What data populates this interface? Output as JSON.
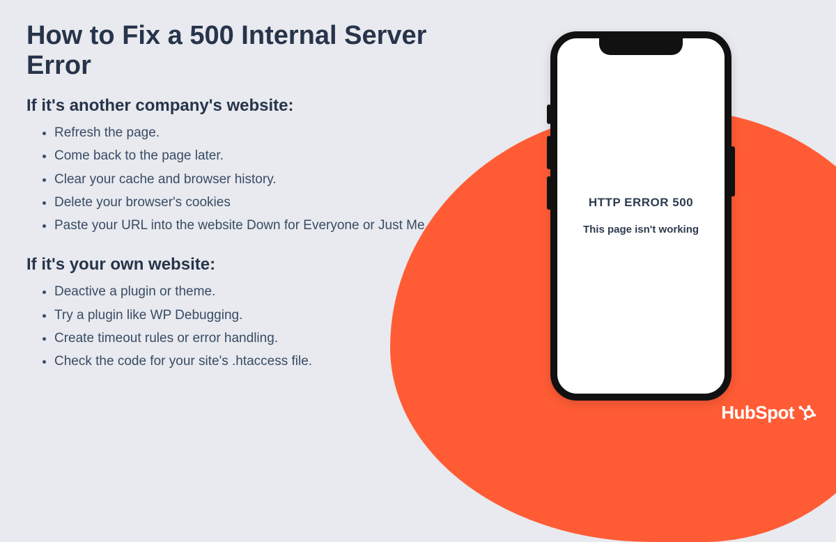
{
  "title": "How to Fix a 500 Internal Server Error",
  "sections": [
    {
      "heading": "If it's another company's website:",
      "items": [
        "Refresh the page.",
        "Come back to the page later.",
        "Clear your cache and browser history.",
        "Delete your browser's cookies",
        "Paste your URL into the website Down for Everyone or Just Me"
      ]
    },
    {
      "heading": "If it's your own website:",
      "items": [
        "Deactive a plugin or theme.",
        "Try a plugin like WP Debugging.",
        "Create timeout rules or error handling.",
        "Check the code for your site's .htaccess file."
      ]
    }
  ],
  "phone": {
    "error_title": "HTTP ERROR 500",
    "error_sub": "This page isn't working"
  },
  "brand": "HubSpot",
  "colors": {
    "accent": "#ff5c35",
    "bg": "#e8eaef",
    "text": "#2e3b4e"
  }
}
